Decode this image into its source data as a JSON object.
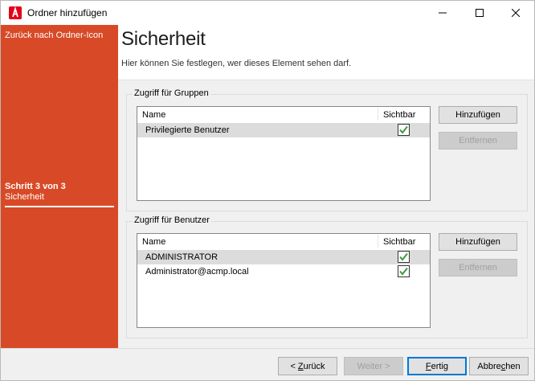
{
  "window": {
    "title": "Ordner hinzufügen",
    "app_icon": "acmp-logo-icon"
  },
  "sidebar": {
    "back_link": "Zurück nach Ordner-Icon",
    "step": "Schritt 3 von 3",
    "step_name": "Sicherheit",
    "color": "#d84a27"
  },
  "page": {
    "title": "Sicherheit",
    "subtitle": "Hier können Sie festlegen, wer dieses Element sehen darf."
  },
  "groups": {
    "label": "Zugriff für Gruppen",
    "columns": [
      "Name",
      "Sichtbar"
    ],
    "rows": [
      {
        "name": "Privilegierte Benutzer",
        "visible": true,
        "selected": true
      }
    ],
    "add_label": "Hinzufügen",
    "remove_label": "Entfernen"
  },
  "users": {
    "label": "Zugriff für Benutzer",
    "columns": [
      "Name",
      "Sichtbar"
    ],
    "rows": [
      {
        "name": "ADMINISTRATOR",
        "visible": true,
        "selected": true
      },
      {
        "name": "Administrator@acmp.local",
        "visible": true,
        "selected": false
      }
    ],
    "add_label": "Hinzufügen",
    "remove_label": "Entfernen"
  },
  "footer": {
    "back_prefix": "< ",
    "back_key": "Z",
    "back_rest": "urück",
    "next_label": "Weiter >",
    "finish_key": "F",
    "finish_rest": "ertig",
    "cancel_pre": "Abbre",
    "cancel_key": "c",
    "cancel_rest": "hen"
  },
  "colors": {
    "accent": "#d84a27",
    "check": "#3c9a3c",
    "selection": "#dcdcdc"
  }
}
